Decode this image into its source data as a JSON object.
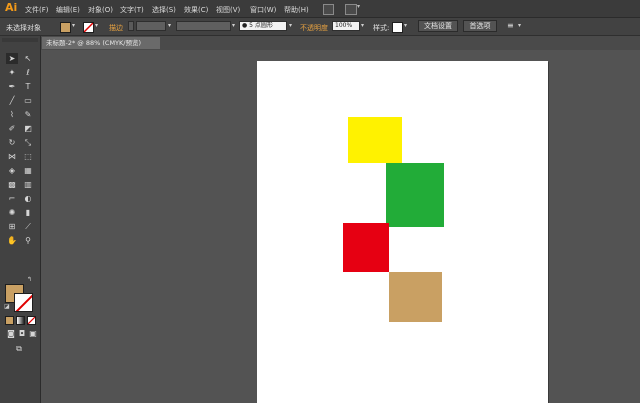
{
  "app": {
    "logo": "Ai"
  },
  "menubar": {
    "items": [
      "文件(F)",
      "编辑(E)",
      "对象(O)",
      "文字(T)",
      "选择(S)",
      "效果(C)",
      "视图(V)",
      "窗口(W)",
      "帮助(H)"
    ],
    "icons": [
      "bridge-icon",
      "arrange-documents-icon"
    ]
  },
  "controlbar": {
    "selection": "未选择对象",
    "stroke_label": "描边",
    "brush_value": "5 点圆形",
    "opacity_label": "不透明度",
    "opacity_value": "100%",
    "style_label": "样式:",
    "doc_setup": "文档设置",
    "preferences": "首选项",
    "fill_color": "#c9a063"
  },
  "tab": {
    "title": "未标题-2* @ 88% (CMYK/预览)",
    "close": "×"
  },
  "tools": {
    "fill_color": "#c9a063",
    "stroke": "none"
  },
  "canvas": {
    "shapes": [
      {
        "name": "yellow-square",
        "color": "#fff200"
      },
      {
        "name": "green-square",
        "color": "#22ac38"
      },
      {
        "name": "red-square",
        "color": "#e60012"
      },
      {
        "name": "tan-square",
        "color": "#c9a063"
      }
    ]
  }
}
